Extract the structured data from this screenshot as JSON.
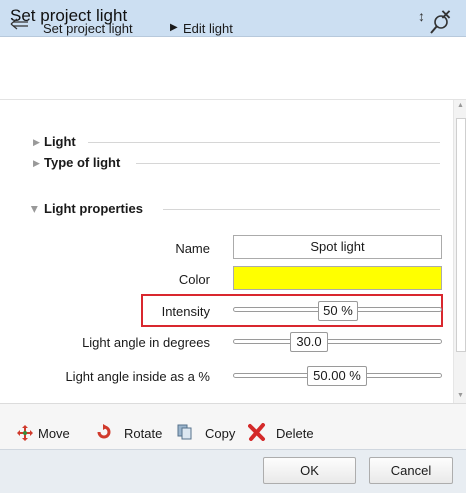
{
  "window": {
    "title": "Set project light",
    "pin_icon": "pin-icon",
    "close_icon": "close-icon"
  },
  "nav": {
    "crumb1": "Set project light",
    "crumb2": "Edit light",
    "back_icon": "back-arrow-icon",
    "search_icon": "search-icon"
  },
  "sections": [
    {
      "label": "Light",
      "expanded": false
    },
    {
      "label": "Type of light",
      "expanded": false
    },
    {
      "label": "Light properties",
      "expanded": true
    }
  ],
  "properties": {
    "name": {
      "label": "Name",
      "value": "Spot light"
    },
    "color": {
      "label": "Color",
      "value": "#ffff00"
    },
    "intensity": {
      "label": "Intensity",
      "value": "50 %",
      "level_percent": 50
    },
    "angle": {
      "label": "Light angle in degrees",
      "value": "30.0"
    },
    "angle_inside": {
      "label": "Light angle inside as a %",
      "value": "50.00 %"
    }
  },
  "toolbar": {
    "move": "Move",
    "rotate": "Rotate",
    "copy": "Copy",
    "delete": "Delete"
  },
  "footer": {
    "ok": "OK",
    "cancel": "Cancel"
  },
  "colors": {
    "title_bar": "#ccdff2",
    "highlight": "#d9272e",
    "color_swatch": "#ffff00"
  }
}
